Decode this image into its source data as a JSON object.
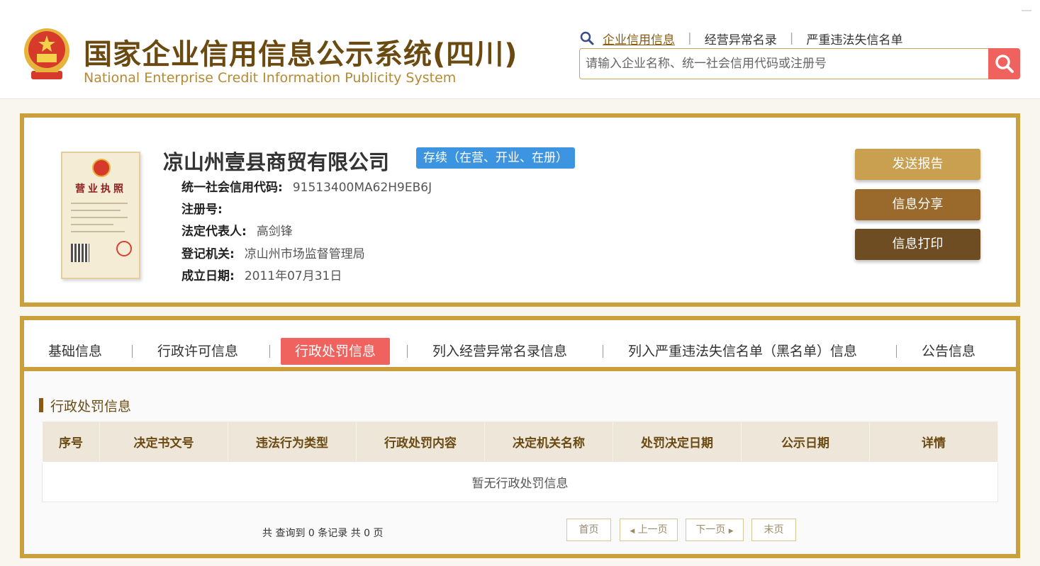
{
  "header": {
    "title_cn": "国家企业信用信息公示系统(四川)",
    "title_en": "National Enterprise Credit Information Publicity System",
    "nav": [
      "企业信用信息",
      "经营异常名录",
      "严重违法失信名单"
    ],
    "search_placeholder": "请输入企业名称、统一社会信用代码或注册号"
  },
  "company": {
    "license_title": "营业执照",
    "name": "凉山州壹县商贸有限公司",
    "status": "存续（在营、开业、在册）",
    "fields": [
      {
        "label": "统一社会信用代码:",
        "value": "91513400MA62H9EB6J"
      },
      {
        "label": "注册号:",
        "value": ""
      },
      {
        "label": "法定代表人:",
        "value": "高剑锋"
      },
      {
        "label": "登记机关:",
        "value": "凉山州市场监督管理局"
      },
      {
        "label": "成立日期:",
        "value": "2011年07月31日"
      }
    ],
    "actions": {
      "send": "发送报告",
      "share": "信息分享",
      "print": "信息打印"
    }
  },
  "tabs": [
    "基础信息",
    "行政许可信息",
    "行政处罚信息",
    "列入经营异常名录信息",
    "列入严重违法失信名单（黑名单）信息",
    "公告信息"
  ],
  "active_tab": "行政处罚信息",
  "section": {
    "title": "行政处罚信息",
    "columns": [
      "序号",
      "决定书文号",
      "违法行为类型",
      "行政处罚内容",
      "决定机关名称",
      "处罚决定日期",
      "公示日期",
      "详情"
    ],
    "empty_text": "暂无行政处罚信息"
  },
  "pagination": {
    "summary": "共 查询到 0 条记录 共 0 页",
    "first": "首页",
    "prev": "上一页",
    "next": "下一页",
    "last": "末页"
  },
  "colors": {
    "gold": "#c9a03c",
    "brown": "#6b4a12",
    "accent_red": "#f0625d",
    "status_blue": "#3d94e0"
  }
}
